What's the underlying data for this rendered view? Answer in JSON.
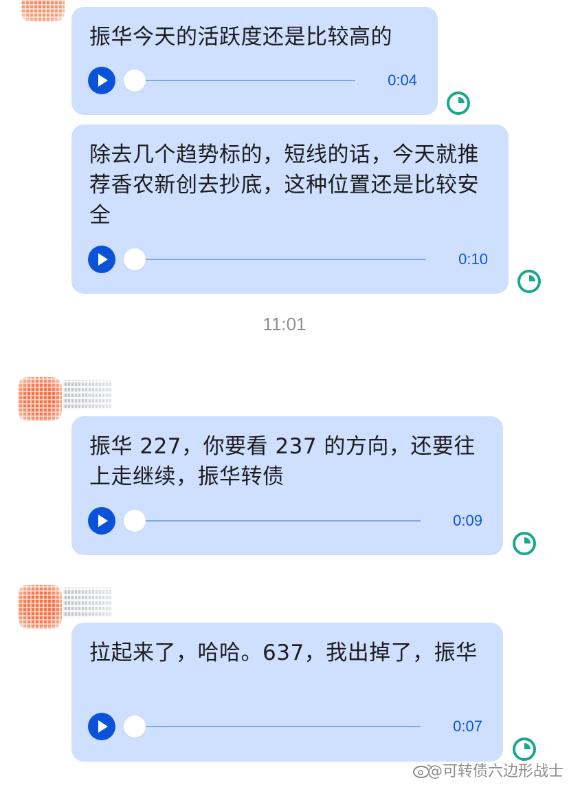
{
  "colors": {
    "bubble_bg": "#cfe0ff",
    "accent": "#0a53d9",
    "status_icon": "#1aa88a",
    "timestamp": "#8e8e93"
  },
  "messages": [
    {
      "text": "振华今天的活跃度还是比较高的",
      "duration": "0:04",
      "progress": 0
    },
    {
      "text": "除去几个趋势标的，短线的话，今天就推荐香农新创去抄底，这种位置还是比较安全",
      "duration": "0:10",
      "progress": 0
    },
    {
      "text": "振华 227，你要看 237 的方向，还要往上走继续，振华转债",
      "duration": "0:09",
      "progress": 0
    },
    {
      "text": "拉起来了，哈哈。637，我出掉了，振华",
      "duration": "0:07",
      "progress": 0
    }
  ],
  "timestamp": "11:01",
  "watermark": "@可转债六边形战士",
  "icons": {
    "play": "play-icon",
    "status": "clock-icon",
    "watermark_logo": "weibo-icon"
  }
}
